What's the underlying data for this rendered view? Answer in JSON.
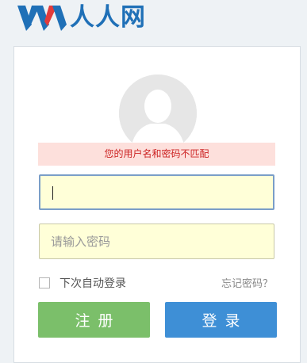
{
  "header": {
    "brand_text": "人人网"
  },
  "login": {
    "error_message": "您的用户名和密码不匹配",
    "username": {
      "value": "",
      "placeholder": ""
    },
    "password": {
      "value": "",
      "placeholder": "请输入密码"
    },
    "remember_label": "下次自动登录",
    "forgot_label": "忘记密码？",
    "register_label": "注册",
    "login_label": "登录"
  },
  "colors": {
    "brand_blue": "#1f70b7",
    "error_bg": "#fde0dc",
    "error_text": "#cc2222",
    "input_bg": "#ffffd8",
    "register_green": "#7bbf6a",
    "login_blue": "#3e8fd6"
  },
  "icons": {
    "logo": "renren-logo-icon",
    "avatar": "default-avatar-icon"
  }
}
